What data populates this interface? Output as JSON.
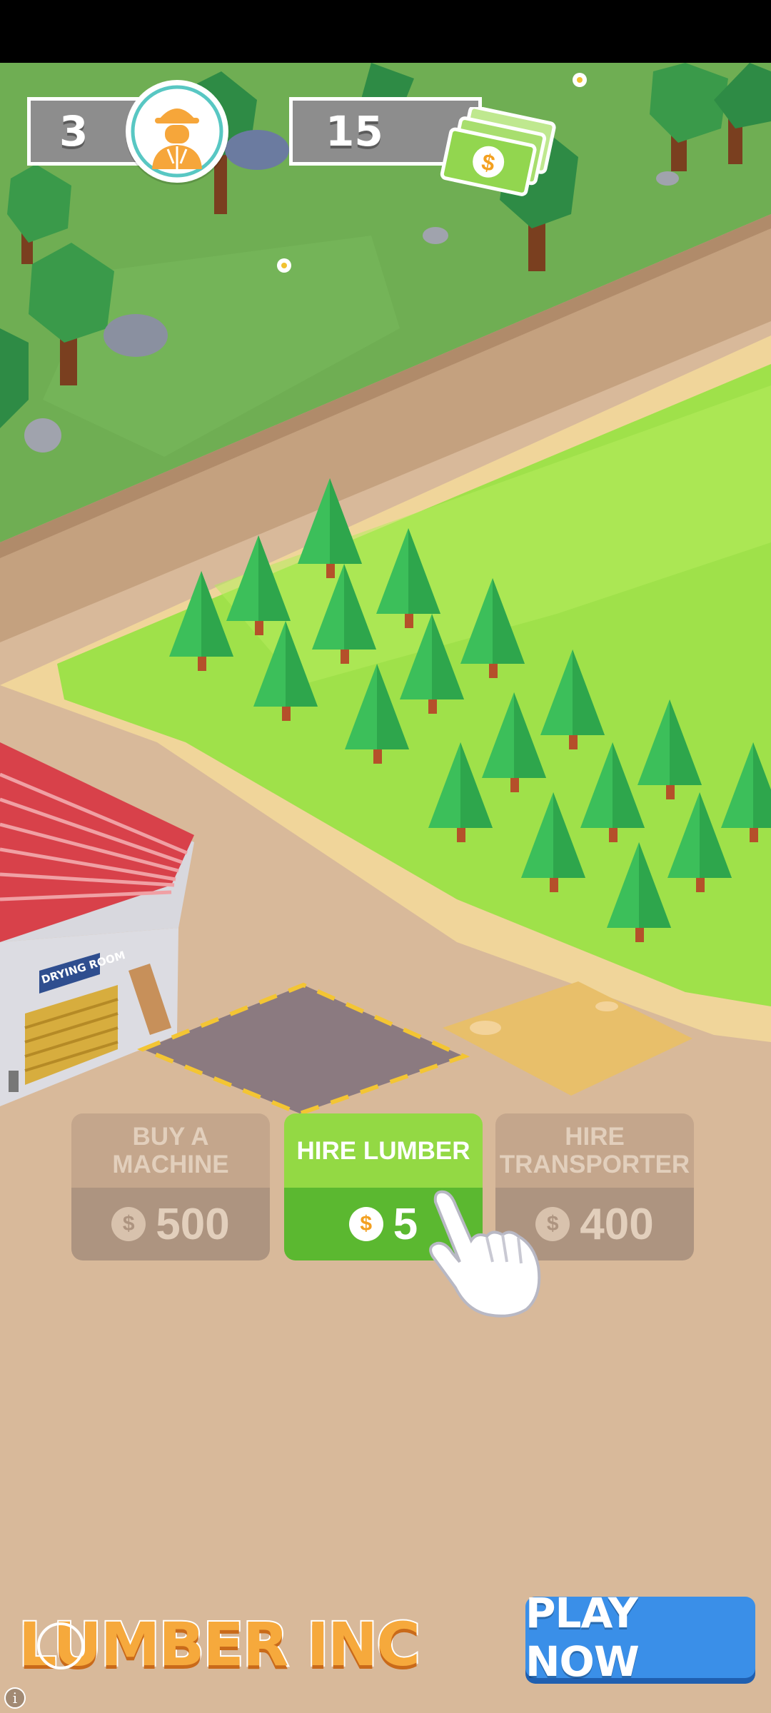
{
  "hud": {
    "workers_count": "3",
    "cash_amount": "15"
  },
  "actions": [
    {
      "label": "BUY A\nMACHINE",
      "price": "500",
      "state": "disabled"
    },
    {
      "label": "HIRE LUMBER",
      "price": "5",
      "state": "active"
    },
    {
      "label": "HIRE\nTRANSPORTER",
      "price": "400",
      "state": "disabled"
    }
  ],
  "coin_symbol": "$",
  "building_sign": "DRYING ROOM",
  "footer": {
    "logo": "LUMBER INC",
    "play_label": "PLAY NOW",
    "info_symbol": "i"
  },
  "colors": {
    "grass": "#6fae53",
    "field": "#9fe14a",
    "sand": "#d8b99a",
    "active_button": "#5bb830",
    "play_button": "#3a8fe8"
  }
}
